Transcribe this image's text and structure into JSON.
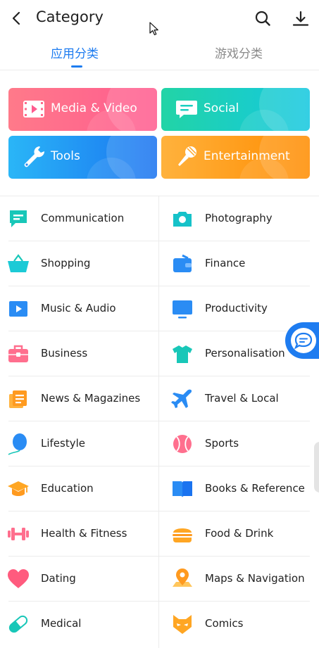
{
  "header": {
    "title": "Category",
    "back_icon": "back-arrow-icon",
    "search_icon": "search-icon",
    "download_icon": "download-icon"
  },
  "tabs": [
    {
      "label": "应用分类",
      "active": true
    },
    {
      "label": "游戏分类",
      "active": false
    }
  ],
  "featured": [
    {
      "label": "Media & Video",
      "icon": "media-video-icon"
    },
    {
      "label": "Social",
      "icon": "social-chat-icon"
    },
    {
      "label": "Tools",
      "icon": "wrench-icon"
    },
    {
      "label": "Entertainment",
      "icon": "microphone-icon"
    }
  ],
  "categories": [
    [
      "Communication",
      "Photography"
    ],
    [
      "Shopping",
      "Finance"
    ],
    [
      "Music & Audio",
      "Productivity"
    ],
    [
      "Business",
      "Personalisation"
    ],
    [
      "News & Magazines",
      "Travel & Local"
    ],
    [
      "Lifestyle",
      "Sports"
    ],
    [
      "Education",
      "Books & Reference"
    ],
    [
      "Health & Fitness",
      "Food & Drink"
    ],
    [
      "Dating",
      "Maps & Navigation"
    ],
    [
      "Medical",
      "Comics"
    ]
  ],
  "colors": {
    "accent": "#1e7cf0",
    "divider": "#ececec"
  }
}
